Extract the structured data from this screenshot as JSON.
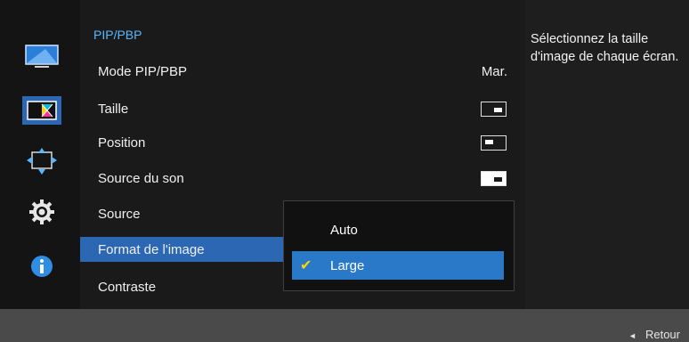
{
  "menu": {
    "title": "PIP/PBP",
    "items": [
      {
        "label": "Mode PIP/PBP",
        "value": "Mar."
      },
      {
        "label": "Taille",
        "icon": "size-small-window-icon"
      },
      {
        "label": "Position",
        "icon": "position-top-left-icon"
      },
      {
        "label": "Source du son",
        "icon": "sound-source-icon"
      },
      {
        "label": "Source"
      },
      {
        "label": "Format de l'image"
      },
      {
        "label": "Contraste"
      }
    ]
  },
  "dropdown": {
    "options": [
      {
        "label": "Auto",
        "selected": false
      },
      {
        "label": "Large",
        "selected": true
      }
    ]
  },
  "help": {
    "text": "Sélectionnez la taille d'image de chaque écran."
  },
  "footer": {
    "back_label": "Retour",
    "back_icon": "left-triangle-icon"
  },
  "rail": {
    "icons": [
      "picture-icon",
      "color-icon",
      "size-position-icon",
      "settings-icon",
      "info-icon"
    ]
  },
  "colors": {
    "accent": "#2c67b3",
    "title": "#58b7ff",
    "check": "#ffd400"
  }
}
